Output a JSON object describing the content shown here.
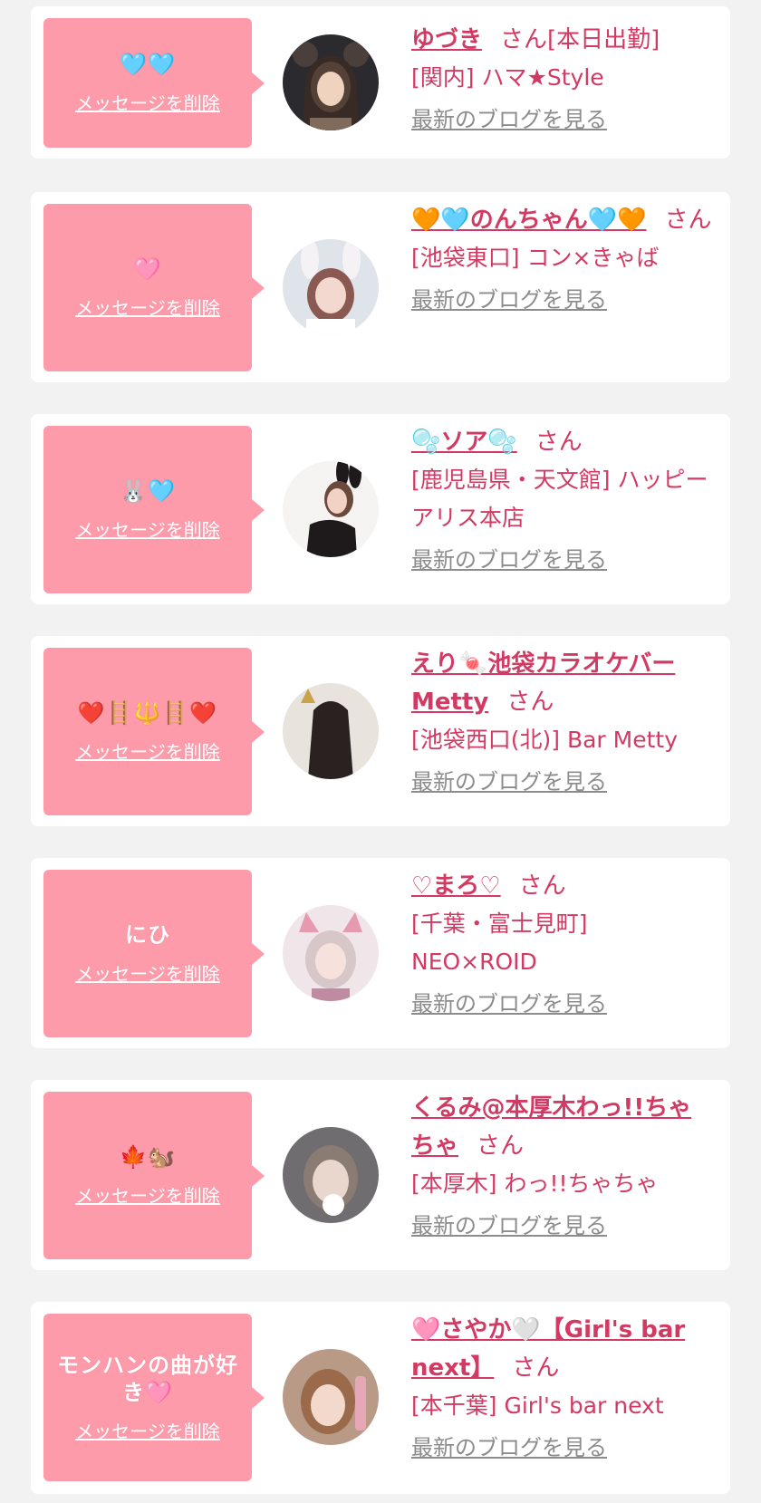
{
  "delete_label": "メッセージを削除",
  "san_label": "さん",
  "blog_label": "最新のブログを見る",
  "colors": {
    "accent": "#d33a63",
    "message_bg": "#fd9bab",
    "muted": "#8c8c8c",
    "page_bg": "#f2f2f2"
  },
  "entries": [
    {
      "message": "🩵🩵",
      "name": "ゆづき",
      "san_suffix": "さん[本日出勤]",
      "shop": "[関内] ハマ★Style"
    },
    {
      "message": "🩷",
      "name": "🧡🩵のんちゃん🩵🧡",
      "san_suffix": "さん",
      "shop": "[池袋東口] コン×きゃば"
    },
    {
      "message": "🐰🩵",
      "name": "🫧ソア🫧",
      "san_suffix": "さん",
      "shop": "[鹿児島県・天文館] ハッピーアリス本店"
    },
    {
      "message": "❤️🪜🔱🪜❤️",
      "name": "えり🍬池袋カラオケバーMetty",
      "san_suffix": "さん",
      "shop": "[池袋西口(北)] Bar Metty"
    },
    {
      "message": "にひ",
      "name": "♡まろ♡",
      "san_suffix": "さん",
      "shop": "[千葉・富士見町] NEO×ROID"
    },
    {
      "message": "🍁🐿️",
      "name": "くるみ@本厚木わっ!!ちゃちゃ",
      "san_suffix": "さん",
      "shop": "[本厚木] わっ!!ちゃちゃ"
    },
    {
      "message": "モンハンの曲が好き🩷",
      "name": "🩷さやか🤍【Girl's bar next】",
      "san_suffix": "さん",
      "shop": "[本千葉] Girl's bar next"
    }
  ]
}
